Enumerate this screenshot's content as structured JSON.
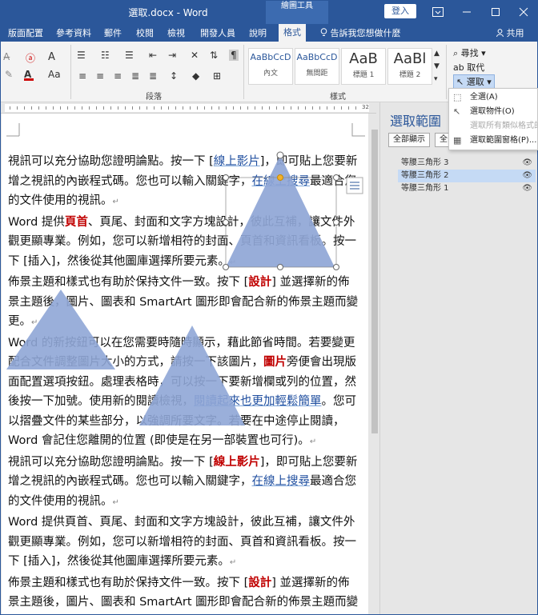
{
  "titlebar": {
    "doc_title": "選取.docx - Word",
    "drawing_tools": "繪圖工具",
    "login": "登入",
    "ribbon_options_icon": "ribbon-display-options-icon",
    "minimize_icon": "minimize-icon",
    "maximize_icon": "maximize-icon",
    "close_icon": "close-icon"
  },
  "tabs": [
    {
      "label": "版面配置"
    },
    {
      "label": "參考資料"
    },
    {
      "label": "郵件"
    },
    {
      "label": "校閱"
    },
    {
      "label": "檢視"
    },
    {
      "label": "開發人員"
    },
    {
      "label": "說明"
    },
    {
      "label": "格式"
    }
  ],
  "tell_me": "告訴我您想做什麼",
  "share": "共用",
  "ribbon": {
    "paragraph_label": "段落",
    "styles_label": "樣式",
    "styles": [
      {
        "sample": "AaBbCcD",
        "name": "內文"
      },
      {
        "sample": "AaBbCcD",
        "name": "無間距"
      },
      {
        "sample": "AaB",
        "name": "標題 1"
      },
      {
        "sample": "AaBl",
        "name": "標題 2"
      }
    ],
    "find": "尋找",
    "replace": "取代",
    "select": "選取"
  },
  "dropdown": {
    "items": [
      {
        "label": "全選(A)",
        "icon": "select-all-icon"
      },
      {
        "label": "選取物件(O)",
        "icon": "select-objects-icon"
      },
      {
        "label": "選取所有類似格式的文字",
        "icon": "select-similar-icon"
      },
      {
        "label": "選取範圍窗格(P)...",
        "icon": "selection-pane-icon"
      }
    ]
  },
  "ruler": {
    "number": "32"
  },
  "document": {
    "lines": [
      [
        "視訊可以充分協助您證明論點。按一下 [",
        {
          "t": "線上影片",
          "c": "blue"
        },
        "]，即可貼上您要新增之視訊的內嵌程式碼。您也可以輸入關鍵字，",
        {
          "t": "在線上搜尋",
          "c": "blue"
        },
        "最適合您的文件使用的視訊。"
      ],
      [
        "Word 提供",
        {
          "t": "頁首",
          "c": "red"
        },
        "、頁尾、封面和文字方塊設計，彼此互補，讓文件外觀更顯專業。例如，您可以新增相符的封面、頁首和資訊看板。按一下 [插入]，然後從其他圖庫選擇所要元素。"
      ],
      [
        "佈景主題和樣式也有助於保持文件一致。按下 [",
        {
          "t": "設計",
          "c": "red"
        },
        "] 並選擇新的佈景主題後，圖片、圖表和 SmartArt 圖形即會配合新的佈景主題而變更。"
      ],
      [
        "Word 的新按鈕可以在您需要時隨時顯示，藉此節省時間。若要變更配合文件調整圖片大小的方式，請按一下該圖片，",
        {
          "t": "圖片",
          "c": "red"
        },
        "旁便會出現版面配置選項按鈕。處理表格時，可以按一下要新增欄或列的位置，然後按一下加號。使用新的閱讀檢視，",
        {
          "t": "閱讀起來也更加輕鬆簡單",
          "c": "blue"
        },
        "。您可以摺疊文件的某些部分，以強調所要文字。若要在中途停止閱讀，Word 會記住您離開的位置 (即使是在另一部裝置也可行)。"
      ],
      [
        "視訊可以充分協助您證明論點。按一下 [",
        {
          "t": "線上影片",
          "c": "red"
        },
        "]，即可貼上您要新增之視訊的內嵌程式碼。您也可以輸入關鍵字，",
        {
          "t": "在線上搜尋",
          "c": "blue"
        },
        "最適合您的文件使用的視訊。"
      ],
      [
        "Word 提供頁首、頁尾、封面和文字方塊設計，彼此互補，讓文件外觀更顯專業。例如，您可以新增相符的封面、頁首和資訊看板。按一下 [插入]，然後從其他圖庫選擇所要元素。"
      ],
      [
        "佈景主題和樣式也有助於保持文件一致。按下 [",
        {
          "t": "設計",
          "c": "red"
        },
        "] 並選擇新的佈景主題後，圖片、圖表和 SmartArt 圖形即會配合新的佈景主題而變更。套用樣式時，標題會配合新的佈景主題加以變更。"
      ]
    ]
  },
  "selection_pane": {
    "title": "選取範圍",
    "show_all": "全部顯示",
    "hide_all": "全",
    "items": [
      {
        "label": "等腰三角形 3",
        "selected": false
      },
      {
        "label": "等腰三角形 2",
        "selected": true
      },
      {
        "label": "等腰三角形 1",
        "selected": false
      }
    ]
  },
  "colors": {
    "brand": "#2b579a",
    "triangle": "#8fa6d6",
    "accent_red": "#c00000"
  }
}
